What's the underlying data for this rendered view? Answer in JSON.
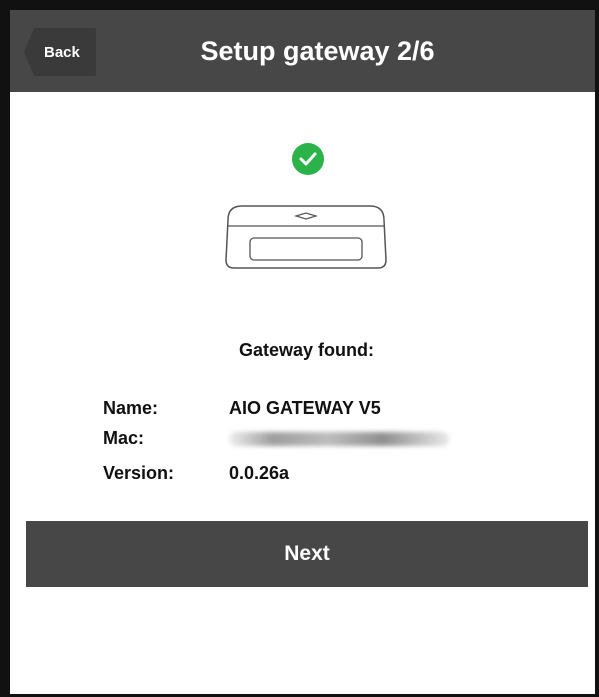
{
  "header": {
    "back_label": "Back",
    "title": "Setup gateway 2/6"
  },
  "status": {
    "icon": "check-circle-icon",
    "color": "#2bb34a",
    "message": "Gateway found:"
  },
  "gateway": {
    "name_label": "Name:",
    "name_value": "AIO GATEWAY V5",
    "mac_label": "Mac:",
    "version_label": "Version:",
    "version_value": "0.0.26a"
  },
  "actions": {
    "next_label": "Next"
  },
  "colors": {
    "header_bg": "#474747",
    "button_bg": "#474747"
  }
}
